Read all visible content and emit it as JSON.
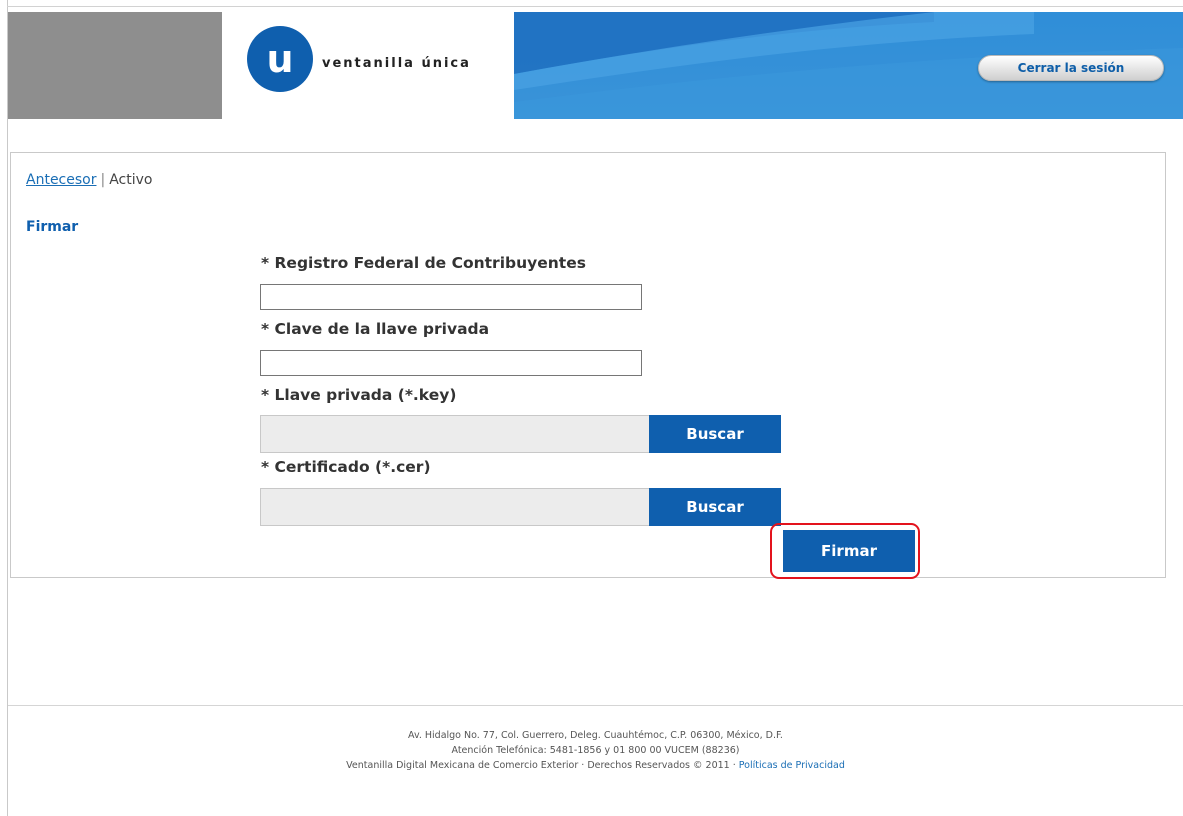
{
  "header": {
    "logo_letter": "u",
    "logo_text": "ventanilla única",
    "logout_label": "Cerrar la sesión"
  },
  "breadcrumb": {
    "previous": "Antecesor",
    "separator": "|",
    "current": "Activo"
  },
  "section_title": "Firmar",
  "form": {
    "rfc_label": "* Registro Federal de Contribuyentes",
    "rfc_value": "",
    "password_label": "* Clave de la llave privada",
    "password_value": "",
    "key_label": "* Llave privada (*.key)",
    "key_button": "Buscar",
    "cert_label": "* Certificado (*.cer)",
    "cert_button": "Buscar",
    "submit_label": "Firmar"
  },
  "footer": {
    "address": "Av. Hidalgo No. 77, Col. Guerrero, Deleg. Cuauhtémoc, C.P. 06300, México, D.F.",
    "phone": "Atención Telefónica: 5481-1856 y 01 800 00 VUCEM (88236)",
    "rights": "Ventanilla Digital Mexicana de Comercio Exterior · Derechos Reservados © 2011 ·",
    "privacy_link": "Políticas de Privacidad"
  },
  "colors": {
    "brand_blue": "#0f5fae",
    "header_blue": "#2f8ed8",
    "highlight_red": "#e3131d"
  }
}
